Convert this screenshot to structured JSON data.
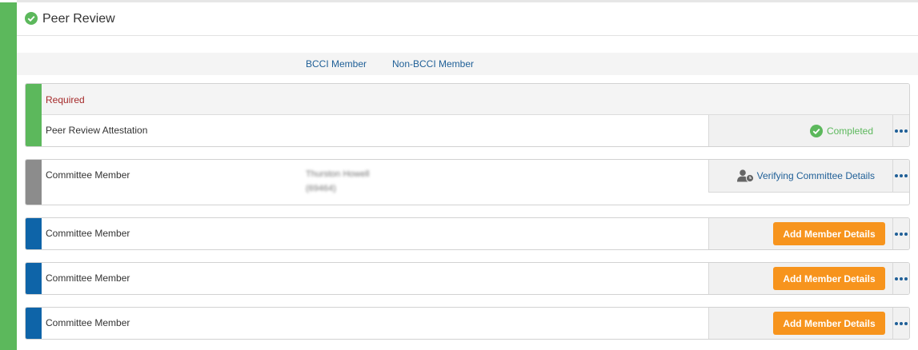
{
  "section": {
    "title": "Peer Review",
    "status_color": "#5cb85c"
  },
  "tabs": [
    {
      "label": "BCCI Member"
    },
    {
      "label": "Non-BCCI Member"
    }
  ],
  "required_card": {
    "heading": "Required",
    "item_label": "Peer Review Attestation",
    "status": "Completed"
  },
  "committee_rows": [
    {
      "label": "Committee Member",
      "member_name": "Thurston Howell",
      "member_id": "(69464)",
      "status": "Verifying Committee Details",
      "strip_color": "#8c8c8c"
    },
    {
      "label": "Committee Member",
      "button": "Add Member Details",
      "strip_color": "#0e64a8"
    },
    {
      "label": "Committee Member",
      "button": "Add Member Details",
      "strip_color": "#0e64a8"
    },
    {
      "label": "Committee Member",
      "button": "Add Member Details",
      "strip_color": "#0e64a8"
    }
  ],
  "colors": {
    "accent_green": "#5cb85c",
    "link_blue": "#1f5f97",
    "button_orange": "#f7941d",
    "required_red": "#a52a2a"
  },
  "icons": {
    "section_status": "check-circle-icon",
    "completed": "check-circle-icon",
    "verifying": "user-clock-icon",
    "more": "ellipsis-icon"
  }
}
